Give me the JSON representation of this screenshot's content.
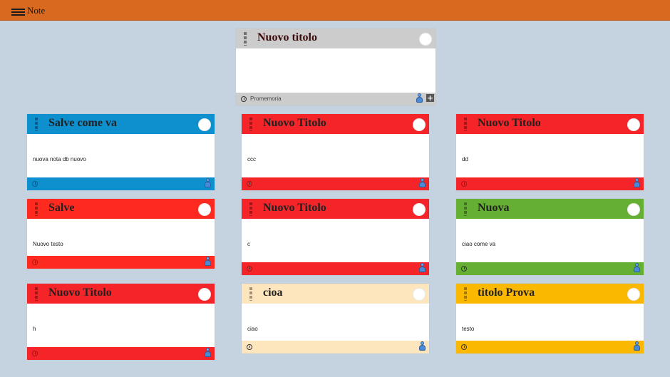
{
  "app": {
    "title": "Note"
  },
  "featured_note": {
    "title": "Nuovo titolo",
    "text": "",
    "footer_label": "Promemoria",
    "color": "#cccccc",
    "icons": [
      "grip-icon",
      "toggle-circle-icon",
      "clock-icon",
      "user-icon",
      "plus-icon"
    ]
  },
  "notes": [
    {
      "title": "Salve come va",
      "text": "nuova nota db nuovo",
      "color": "#0e8fce"
    },
    {
      "title": "Nuovo Titolo",
      "text": "ccc",
      "color": "#f52428"
    },
    {
      "title": "Nuovo Titolo",
      "text": "dd",
      "color": "#f52428"
    },
    {
      "title": "Salve",
      "text": "Nuovo testo",
      "color": "#ff2a1f"
    },
    {
      "title": "Nuovo Titolo",
      "text": "c",
      "color": "#f52428"
    },
    {
      "title": "Nuova",
      "text": "ciao come va",
      "color": "#65af33"
    },
    {
      "title": "Nuovo Titolo",
      "text": "h",
      "color": "#f52428"
    },
    {
      "title": "cioa",
      "text": "ciao",
      "color": "#fde6bd"
    },
    {
      "title": "titolo Prova",
      "text": "testo",
      "color": "#fbb800"
    }
  ]
}
